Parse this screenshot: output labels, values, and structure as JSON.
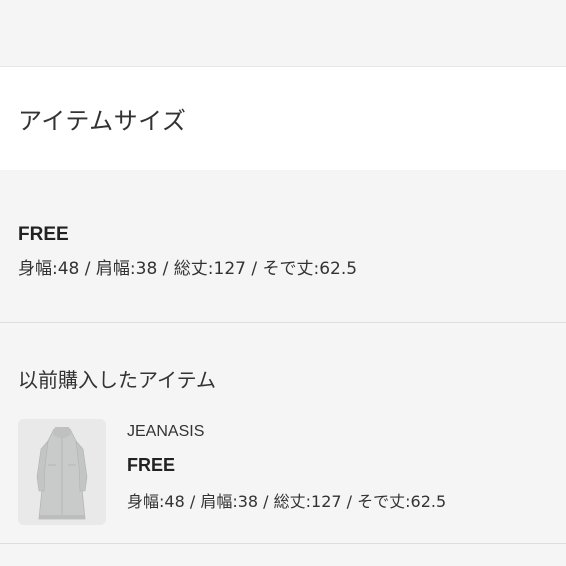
{
  "header": {
    "title": "アイテムサイズ"
  },
  "size": {
    "name": "FREE",
    "detail": "身幅:48 / 肩幅:38 / 総丈:127 / そで丈:62.5"
  },
  "previous": {
    "title": "以前購入したアイテム",
    "items": [
      {
        "brand": "JEANASIS",
        "size": "FREE",
        "detail": "身幅:48 / 肩幅:38 / 総丈:127 / そで丈:62.5",
        "image": "light-gray-long-coat"
      }
    ]
  },
  "colors": {
    "background": "#f5f5f5",
    "header_bg": "#ffffff",
    "thumbnail_bg": "#e8e8e8"
  }
}
